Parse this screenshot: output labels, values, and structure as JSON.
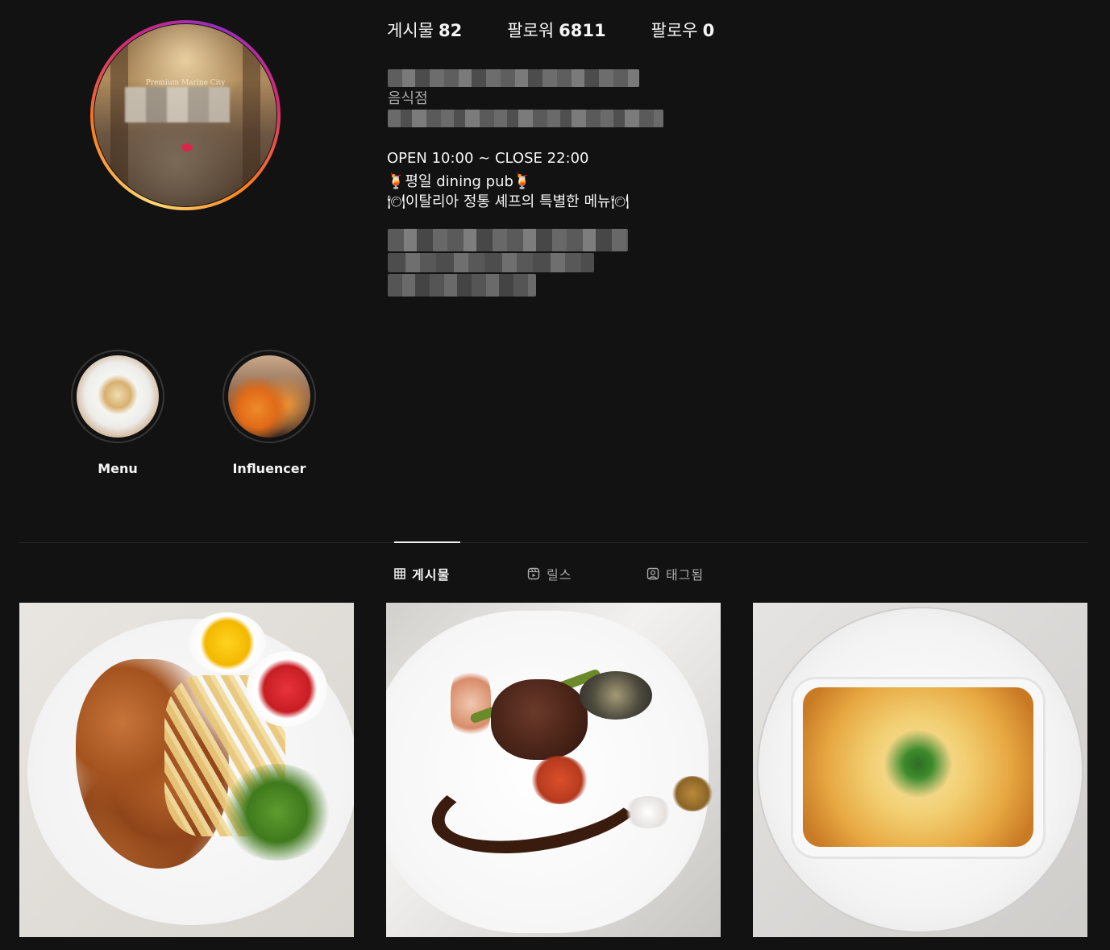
{
  "profile": {
    "avatar": {
      "brand_text": "Premium Marine City"
    },
    "stats": [
      {
        "label": "게시물",
        "value": "82"
      },
      {
        "label": "팔로워",
        "value": "6811"
      },
      {
        "label": "팔로우",
        "value": "0"
      }
    ],
    "category": "음식점",
    "bio_lines": [
      "OPEN 10:00 ~ CLOSE 22:00",
      "🍹평일 dining pub🍹",
      "🍽이탈리아 정통 셰프의 특별한 메뉴🍽"
    ]
  },
  "highlights": [
    {
      "label": "Menu"
    },
    {
      "label": "Influencer"
    }
  ],
  "tabs": [
    {
      "label": "게시물",
      "icon": "grid-icon",
      "active": true
    },
    {
      "label": "릴스",
      "icon": "reels-icon",
      "active": false
    },
    {
      "label": "태그됨",
      "icon": "tagged-icon",
      "active": false
    }
  ],
  "posts": [
    {
      "description": "fried chicken with fries and salad"
    },
    {
      "description": "steak with shrimp and abalone"
    },
    {
      "description": "cheese gratin"
    }
  ],
  "colors": {
    "background": "#121212",
    "text_primary": "#f5f5f5",
    "text_secondary": "#a8a8a8",
    "divider": "#262626"
  }
}
